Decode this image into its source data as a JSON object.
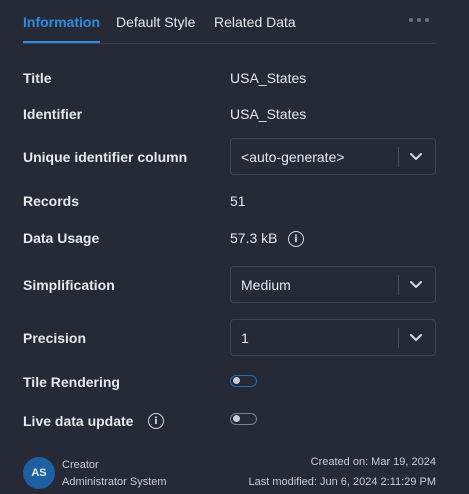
{
  "tabs": [
    {
      "label": "Information",
      "active": true
    },
    {
      "label": "Default Style",
      "active": false
    },
    {
      "label": "Related Data",
      "active": false
    }
  ],
  "more_icon": "more-horizontal-icon",
  "fields": {
    "title": {
      "label": "Title",
      "value": "USA_States"
    },
    "identifier": {
      "label": "Identifier",
      "value": "USA_States"
    },
    "unique_id_column": {
      "label": "Unique identifier column",
      "value": "<auto-generate>"
    },
    "records": {
      "label": "Records",
      "value": "51"
    },
    "data_usage": {
      "label": "Data Usage",
      "value": "57.3 kB",
      "info_icon": "info-icon"
    },
    "simplification": {
      "label": "Simplification",
      "value": "Medium"
    },
    "precision": {
      "label": "Precision",
      "value": "1"
    },
    "tile_rendering": {
      "label": "Tile Rendering",
      "enabled": false
    },
    "live_data_update": {
      "label": "Live data update",
      "enabled": false,
      "info_icon": "info-icon"
    }
  },
  "footer": {
    "avatar_initials": "AS",
    "creator_label": "Creator",
    "creator_name": "Administrator System",
    "created_on": "Created on: Mar 19, 2024",
    "last_modified": "Last modified: Jun 6, 2024 2:11:29 PM"
  },
  "colors": {
    "background": "#262a37",
    "accent": "#2b8de0",
    "text": "#e6e8ee",
    "border": "#3f4452",
    "avatar": "#1d5fa3"
  }
}
